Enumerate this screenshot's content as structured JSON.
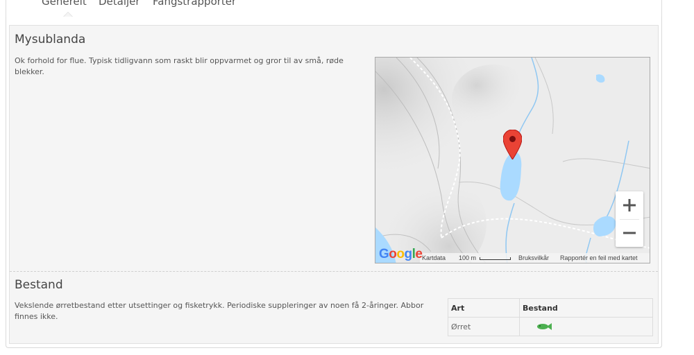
{
  "tabs": [
    {
      "label": "Generelt",
      "active": true
    },
    {
      "label": "Detaljer",
      "active": false
    },
    {
      "label": "Fangstrapporter",
      "active": false
    }
  ],
  "lake": {
    "name": "Mysublanda",
    "description": "Ok forhold for flue. Typisk tidligvann som raskt blir oppvarmet og gror til av små, røde blekker."
  },
  "map": {
    "zoom_in": "+",
    "zoom_out": "−",
    "logo": "Google",
    "footer": {
      "map_data": "Kartdata",
      "scale": "100 m",
      "terms": "Bruksvilkår",
      "report": "Rapportér en feil med kartet"
    },
    "icons": {
      "marker": "map-marker-icon",
      "fish": "fish-icon"
    },
    "colors": {
      "water": "#aadaff",
      "marker": "#ea4335",
      "fish": "#4caf50"
    }
  },
  "stock": {
    "title": "Bestand",
    "description": "Vekslende ørretbestand etter utsettinger og fisketrykk. Periodiske suppleringer av noen få 2-åringer. Abbor finnes ikke.",
    "table": {
      "headers": [
        "Art",
        "Bestand"
      ],
      "rows": [
        {
          "species": "Ørret",
          "stock_icon": "fish-icon"
        }
      ]
    }
  }
}
